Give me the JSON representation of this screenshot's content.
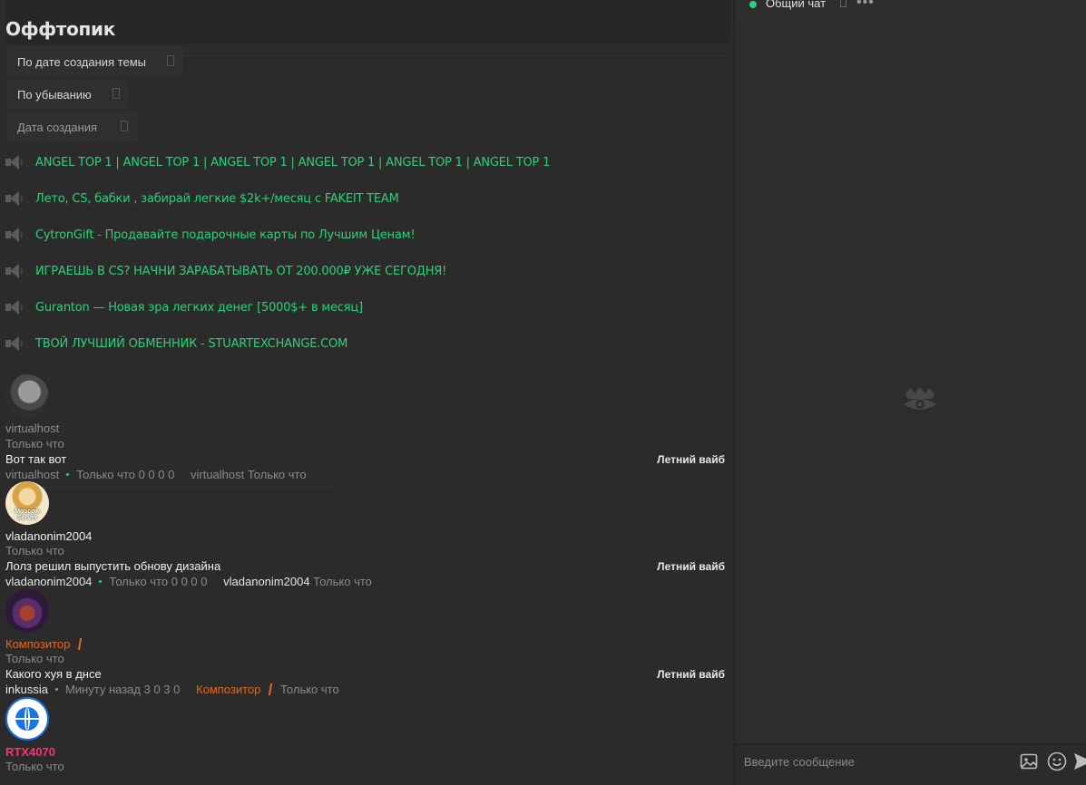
{
  "page": {
    "title": "Оффтопик"
  },
  "filters": [
    {
      "label": "По дате создания темы"
    },
    {
      "label": "По убыванию"
    },
    {
      "label": "Дата создания"
    }
  ],
  "promos": [
    {
      "text": "ANGEL TOP 1 | ANGEL TOP 1 | ANGEL TOP 1 | ANGEL TOP 1 | ANGEL TOP 1 | ANGEL TOP 1"
    },
    {
      "text": "Лето, CS, бабки , забирай легкие $2k+/месяц с FAKEIT TEAM"
    },
    {
      "text": "CytronGift - Продавайте подарочные карты по Лучшим Ценам!"
    },
    {
      "text": "ИГРАЕШЬ В CS? НАЧНИ ЗАРАБАТЫВАТЬ ОТ 200.000₽ УЖЕ СЕГОДНЯ!"
    },
    {
      "text": "Guranton — Новая эра легких денег [5000$+ в месяц]"
    },
    {
      "text": "ТВОЙ ЛУЧШИЙ ОБМЕННИК - STUARTEXCHANGE.COM"
    }
  ],
  "threads": [
    {
      "author": "virtualhost",
      "time": "Только что",
      "topic": "Вот так вот",
      "forum": "Летний вайб",
      "meta_user": "virtualhost",
      "meta_time": "Только что",
      "stats": "0 0 0 0",
      "last_user": "virtualhost",
      "last_time": "Только что"
    },
    {
      "author": "vladanonim2004",
      "avatar_text": "Moscow Server",
      "time": "Только что",
      "topic": "Лолз решил выпустить обнову дизайна",
      "forum": "Летний вайб",
      "meta_user": "vladanonim2004",
      "meta_time": "Только что",
      "stats": "0 0 0 0",
      "last_user": "vladanonim2004",
      "last_time": "Только что"
    },
    {
      "author": "Композитор",
      "time": "Только что",
      "topic": "Какого хуя в днсе",
      "forum": "Летний вайб",
      "meta_user": "inkussia",
      "meta_time": "Минуту назад",
      "stats": "3 0 3 0",
      "last_user": "Композитор",
      "last_time": "Только что"
    },
    {
      "author": "RTX4070",
      "time": "Только что"
    }
  ],
  "chat": {
    "title": "Общий чат",
    "placeholder": "Введите сообщение"
  },
  "colors": {
    "promo_green": "#2ecf7a",
    "username_orange": "#e8641c",
    "username_pink": "#ff2e6e",
    "online_dot": "#2ecf7a",
    "background": "#2b2b2b"
  },
  "icons": {
    "promo": "megaphone-icon",
    "chat_image": "image-icon",
    "chat_emoji": "smile-icon",
    "chat_send": "send-icon",
    "chat_more": "more-icon",
    "chat_empty": "logo-icon"
  }
}
